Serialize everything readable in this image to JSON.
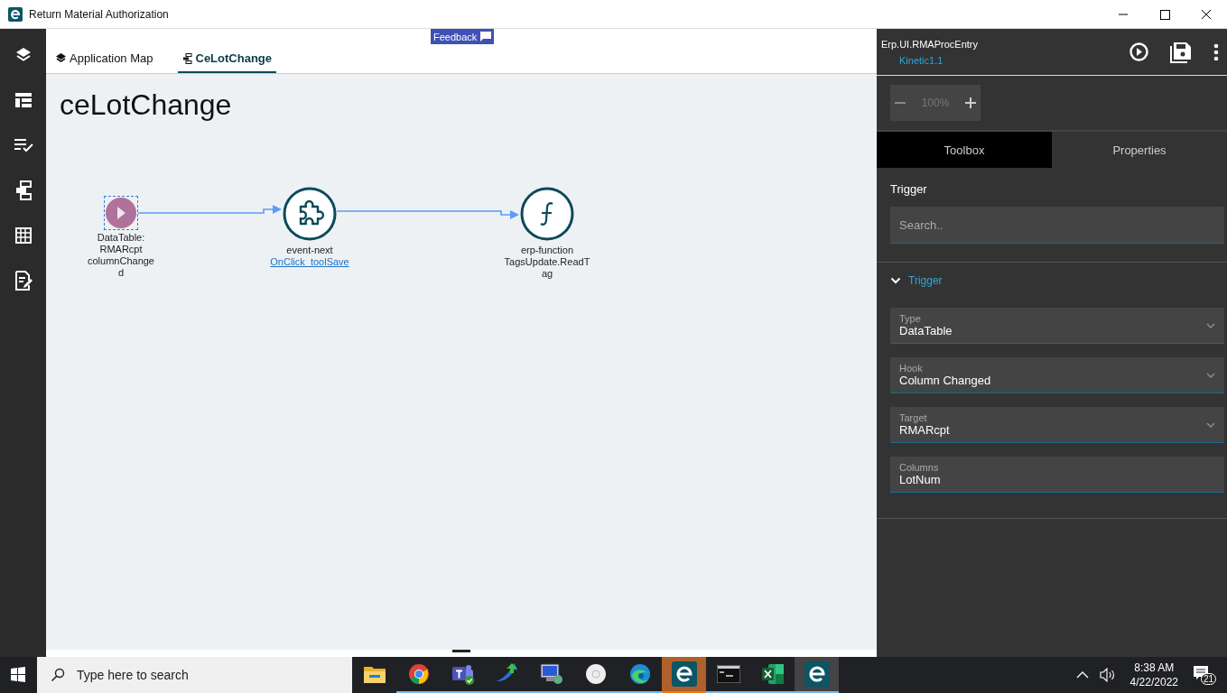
{
  "window": {
    "title": "Return Material Authorization"
  },
  "rail": [
    {
      "kind": "layers",
      "selected": false
    },
    {
      "kind": "layout",
      "selected": false
    },
    {
      "kind": "checklist",
      "selected": false
    },
    {
      "kind": "events",
      "selected": false
    },
    {
      "kind": "grid",
      "selected": false
    },
    {
      "kind": "edit",
      "selected": false
    }
  ],
  "feedback": {
    "label": "Feedback"
  },
  "tabs": [
    {
      "label": "Application Map",
      "kind": "map",
      "selected": false
    },
    {
      "label": "CeLotChange",
      "kind": "event",
      "selected": true
    }
  ],
  "canvas": {
    "heading": "ceLotChange",
    "nodes": [
      {
        "kind": "trigger",
        "selected": true,
        "lines": [
          "DataTable:",
          "RMARcpt",
          "columnChange",
          "d"
        ]
      },
      {
        "kind": "event",
        "selected": false,
        "lines": [
          "event-next"
        ],
        "link": "OnClick_toolSave"
      },
      {
        "kind": "function",
        "selected": false,
        "lines": [
          "erp-function",
          "TagsUpdate.ReadT",
          "ag"
        ]
      }
    ]
  },
  "panel": {
    "app": "Erp.UI.RMAProcEntry",
    "version": "Kinetic1.1",
    "zoom": "100%",
    "tabs": [
      {
        "label": "Toolbox",
        "selected": true
      },
      {
        "label": "Properties",
        "selected": false
      }
    ],
    "section_title": "Trigger",
    "search": {
      "placeholder": "Search.."
    },
    "group": {
      "title": "Trigger",
      "expanded": true,
      "fields": [
        {
          "label": "Type",
          "value": "DataTable",
          "kind": "dropdown"
        },
        {
          "label": "Hook",
          "value": "Column Changed",
          "kind": "dropdown"
        },
        {
          "label": "Target",
          "value": "RMARcpt",
          "kind": "dropdown"
        },
        {
          "label": "Columns",
          "value": "LotNum",
          "kind": "text"
        }
      ]
    }
  },
  "taskbar": {
    "search": {
      "placeholder": "Type here to search"
    },
    "apps": [
      {
        "kind": "folder",
        "running": false,
        "selected": false,
        "flashing": false
      },
      {
        "kind": "browser",
        "running": true,
        "selected": false,
        "flashing": false
      },
      {
        "kind": "chat",
        "running": true,
        "selected": false,
        "flashing": false
      },
      {
        "kind": "arrow",
        "running": true,
        "selected": false,
        "flashing": false
      },
      {
        "kind": "monitor",
        "running": true,
        "selected": false,
        "flashing": false
      },
      {
        "kind": "disc",
        "running": true,
        "selected": false,
        "flashing": false
      },
      {
        "kind": "edge",
        "running": true,
        "selected": false,
        "flashing": false
      },
      {
        "kind": "e",
        "running": true,
        "selected": false,
        "flashing": true
      },
      {
        "kind": "console",
        "running": true,
        "selected": false,
        "flashing": false
      },
      {
        "kind": "sheet",
        "running": true,
        "selected": false,
        "flashing": false
      },
      {
        "kind": "e",
        "running": true,
        "selected": true,
        "flashing": false
      }
    ],
    "time": "8:38 AM",
    "date": "4/22/2022",
    "notifications": "21"
  }
}
